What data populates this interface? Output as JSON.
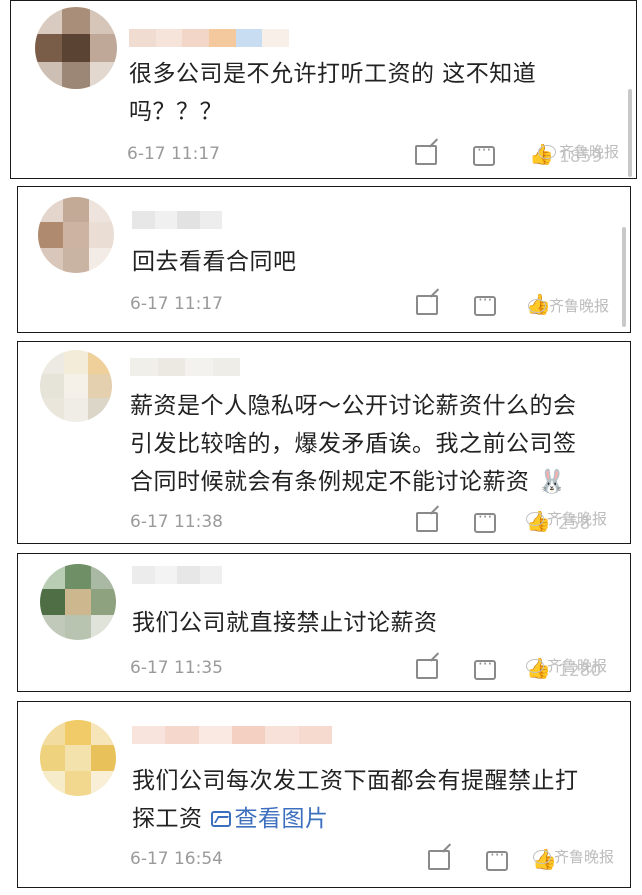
{
  "comments": [
    {
      "text": "很多公司是不允许打听工资的 这不知道吗？？？",
      "line1": "很多公司是不允许打听工资的 这不知道",
      "line2": "吗？？？",
      "time": "6-17 11:17",
      "likes": "1859",
      "avatar_colors": [
        "#d9cbc0",
        "#a98f79",
        "#d6c6ba",
        "#7a5d48",
        "#5a4333",
        "#bfa898",
        "#cdbfb4",
        "#9c8675",
        "#e3d8cf"
      ],
      "name_colors": [
        "#f1dcd2",
        "#f6e3da",
        "#f2d6c7",
        "#f4c99e",
        "#c9ddf2",
        "#f7efe8"
      ]
    },
    {
      "text": "回去看看合同吧",
      "time": "6-17 11:17",
      "likes": "",
      "avatar_colors": [
        "#e4d6cc",
        "#c2aa97",
        "#eee4dd",
        "#b08a6f",
        "#cdb4a2",
        "#e9ddd4",
        "#d8c7ba",
        "#c9b3a3",
        "#f2ebe6"
      ],
      "name_colors": [
        "#e7e7e7",
        "#f0f0f0",
        "#e2e2e2",
        "#ededed"
      ]
    },
    {
      "text": "薪资是个人隐私呀～公开讨论薪资什么的会引发比较啥的，爆发矛盾诶。我之前公司签合同时候就会有条例规定不能讨论薪资",
      "line1": "薪资是个人隐私呀～公开讨论薪资什么的会",
      "line2": "引发比较啥的，爆发矛盾诶。我之前公司签",
      "line3": "合同时候就会有条例规定不能讨论薪资",
      "emoji": "🐰",
      "time": "6-17 11:38",
      "likes": "258",
      "avatar_colors": [
        "#eceae3",
        "#f3ecd9",
        "#efcf9a",
        "#e6e3d9",
        "#f5f1e8",
        "#e4cfae",
        "#ebe6dc",
        "#f0ede6",
        "#dcd6c8"
      ],
      "name_colors": [
        "#f1efe9",
        "#ece9e2",
        "#f4f2ee",
        "#efede8"
      ]
    },
    {
      "text": "我们公司就直接禁止讨论薪资",
      "time": "6-17 11:35",
      "likes": "1280",
      "avatar_colors": [
        "#b8cdb4",
        "#6f8f66",
        "#a9b9a4",
        "#4f6e45",
        "#cdb78f",
        "#8ea27f",
        "#c1c9ba",
        "#b8c4b0",
        "#dfe3da"
      ],
      "name_colors": [
        "#ececec",
        "#f3f3f3",
        "#e7e7e7",
        "#efefef"
      ]
    },
    {
      "text": "我们公司每次发工资下面都会有提醒禁止打探工资",
      "line1": "我们公司每次发工资下面都会有提醒禁止打",
      "line2": "探工资",
      "link": "查看图片",
      "time": "6-17 16:54",
      "likes": "",
      "avatar_colors": [
        "#f3dc9f",
        "#f0cb67",
        "#f6e5b8",
        "#efd27e",
        "#f4e2ad",
        "#e9c15b",
        "#f7ecca",
        "#f2d88f",
        "#f8efd6"
      ],
      "name_colors": [
        "#f8e4dc",
        "#f5d7cb",
        "#f9e9e2",
        "#f3d0c2",
        "#f7e1d8",
        "#f6dacf"
      ]
    }
  ],
  "watermark": "齐鲁晚报",
  "icons": [
    "share-icon",
    "comment-icon",
    "like-icon",
    "picture-icon"
  ]
}
